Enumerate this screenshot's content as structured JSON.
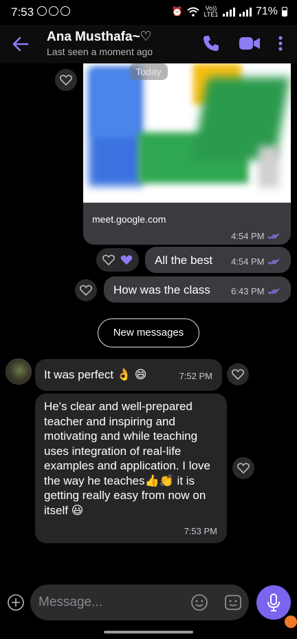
{
  "status_bar": {
    "time": "7:53",
    "network": "Vo)) LTE1",
    "battery": "71%"
  },
  "header": {
    "contact_name": "Ana Musthafa~♡",
    "last_seen": "Last seen a moment ago"
  },
  "date_chip": "Today",
  "messages": [
    {
      "type": "sent-link",
      "link_text": "meet.google.com",
      "time": "4:54 PM"
    },
    {
      "type": "sent",
      "text": "All the best",
      "time": "4:54 PM"
    },
    {
      "type": "sent",
      "text": "How was the class",
      "time": "6:43 PM"
    },
    {
      "type": "received",
      "text": "It was perfect 👌 😄",
      "time": "7:52 PM"
    },
    {
      "type": "received",
      "text": "He's clear and well-prepared teacher and inspiring and motivating and while teaching uses integration of real-life examples and application. I love the way he teaches👍👏 it is getting really easy from now on itself 😃",
      "time": "7:53 PM"
    }
  ],
  "new_messages_label": "New messages",
  "composer": {
    "placeholder": "Message..."
  },
  "colors": {
    "accent": "#7c64f0",
    "check": "#8c7cf5",
    "sent_bubble": "#3a3a3f",
    "received_bubble": "#262628"
  },
  "icons": [
    "back-arrow-icon",
    "phone-icon",
    "video-icon",
    "more-vert-icon",
    "heart-icon",
    "heart-filled-icon",
    "read-check-icon",
    "add-icon",
    "emoji-icon",
    "sticker-icon",
    "mic-icon"
  ]
}
